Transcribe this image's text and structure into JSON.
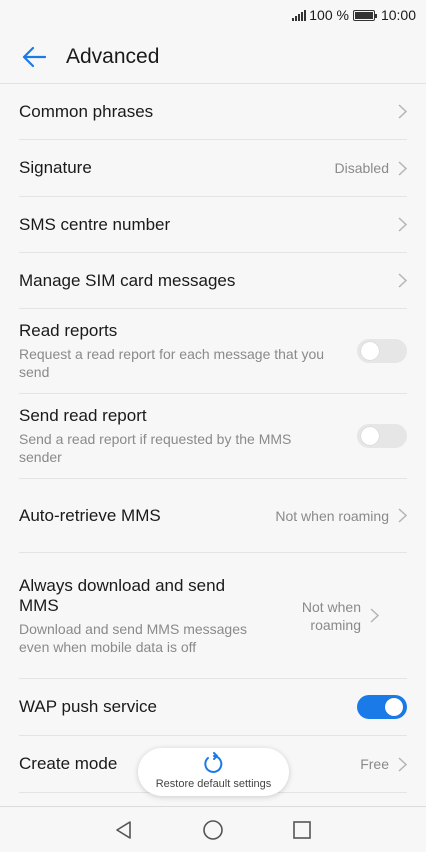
{
  "status": {
    "battery": "100 %",
    "time": "10:00"
  },
  "header": {
    "title": "Advanced"
  },
  "items": [
    {
      "title": "Common phrases"
    },
    {
      "title": "Signature",
      "value": "Disabled"
    },
    {
      "title": "SMS centre number"
    },
    {
      "title": "Manage SIM card messages"
    },
    {
      "title": "Read reports",
      "subtitle": "Request a read report for each message that you send",
      "enabled": false
    },
    {
      "title": "Send read report",
      "subtitle": "Send a read report if requested by the MMS sender",
      "enabled": false
    },
    {
      "title": "Auto-retrieve MMS",
      "value": "Not when roaming"
    },
    {
      "title": "Always download and send MMS",
      "subtitle": "Download and send MMS messages even when mobile data is off",
      "value": "Not when roaming"
    },
    {
      "title": "WAP push service",
      "enabled": true
    },
    {
      "title": "Create mode",
      "value": "Free"
    }
  ],
  "toast": {
    "label": "Restore default settings"
  },
  "colors": {
    "accent": "#1a7ae8",
    "text": "#1a1a1a",
    "secondary": "#8a8a8a",
    "background": "#f7f7f7"
  },
  "icons": {
    "back": "arrow-left-icon",
    "chevron": "chevron-right-icon",
    "reset": "refresh-icon",
    "nav": [
      "back-triangle-icon",
      "home-circle-icon",
      "recents-square-icon"
    ]
  }
}
